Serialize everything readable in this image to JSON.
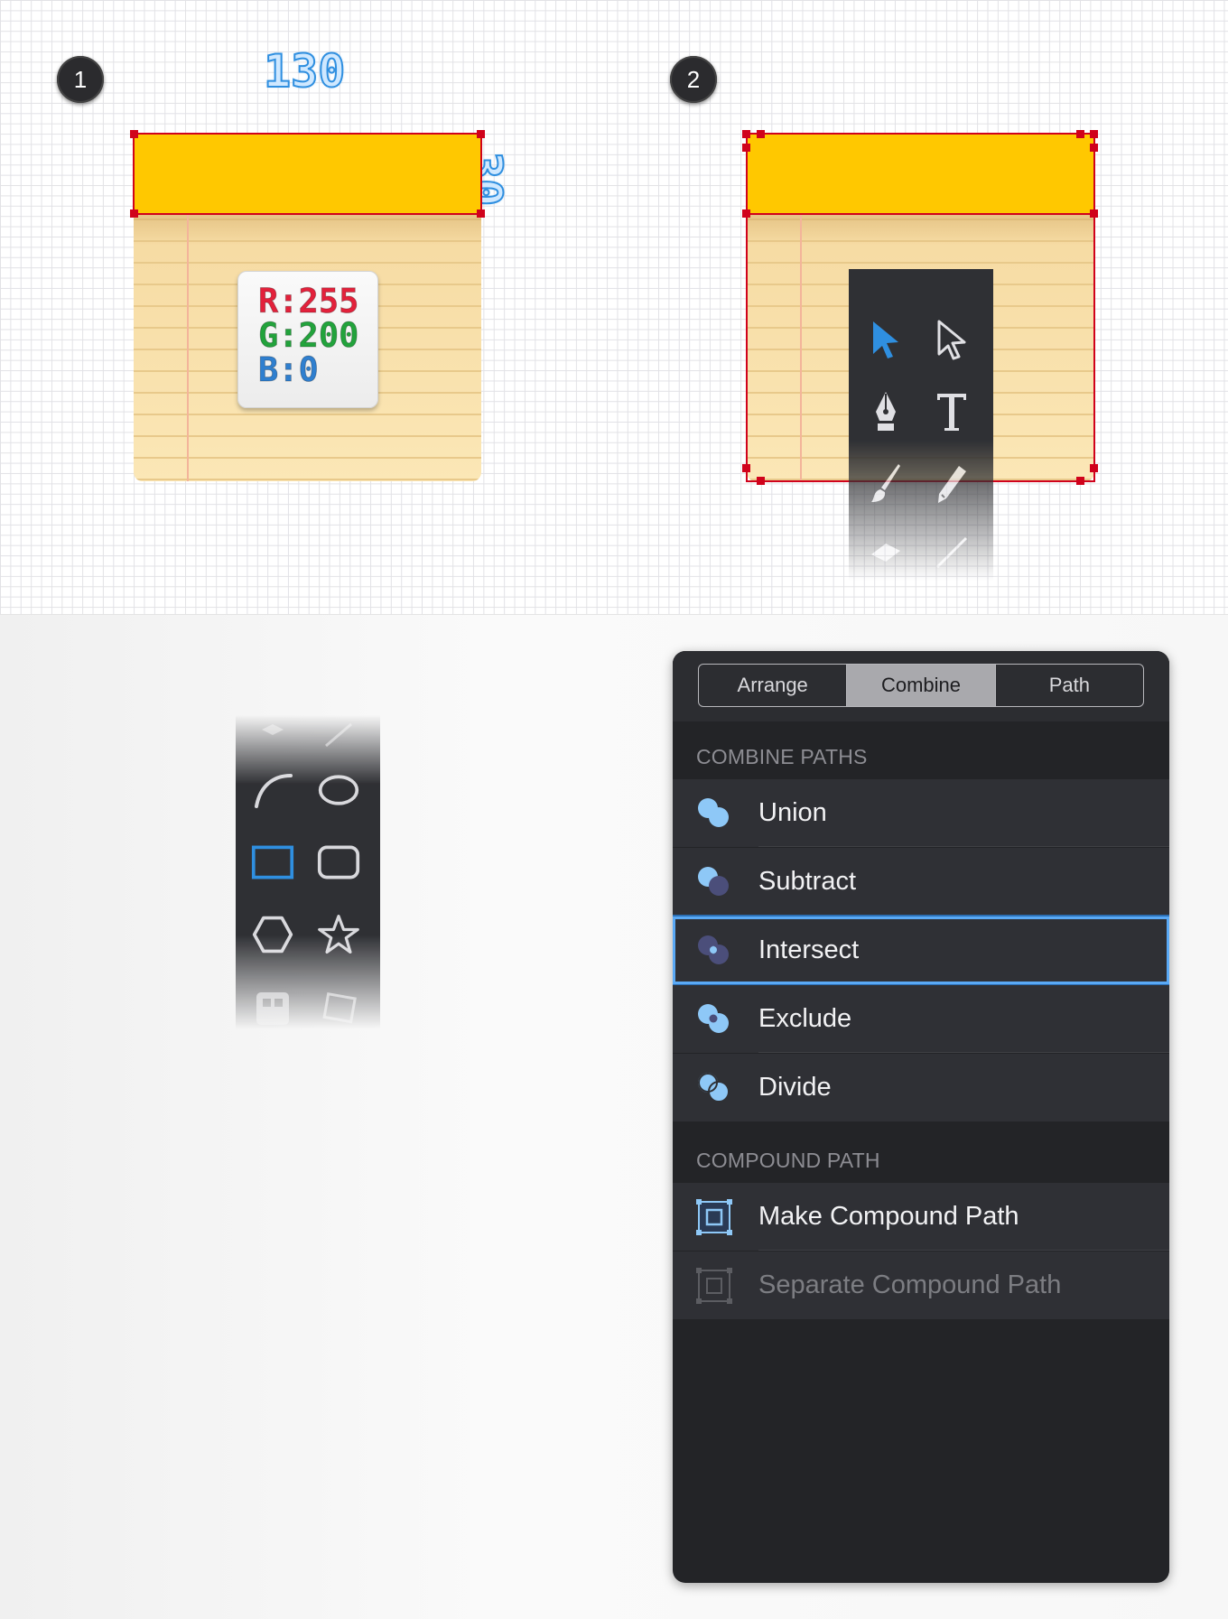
{
  "steps": {
    "one": "1",
    "two": "2"
  },
  "dimensions": {
    "width": "130",
    "height": "30"
  },
  "rgb": {
    "r": "R:255",
    "g": "G:200",
    "b": "B:0"
  },
  "colors": {
    "binding": "#ffc800",
    "selection": "#d0021b",
    "accent": "#2f8fe0",
    "r": "#e3213b",
    "g": "#22a33c",
    "b": "#2f7fcf"
  },
  "tools_top": [
    {
      "name": "select-arrow-icon",
      "active": true
    },
    {
      "name": "direct-select-arrow-icon"
    },
    {
      "name": "pen-icon"
    },
    {
      "name": "text-icon"
    },
    {
      "name": "brush-icon"
    },
    {
      "name": "pencil-icon"
    },
    {
      "name": "eraser-icon"
    },
    {
      "name": "line-icon"
    }
  ],
  "tools_shapes": [
    {
      "name": "arc-icon"
    },
    {
      "name": "ellipse-icon"
    },
    {
      "name": "rectangle-icon",
      "active": true
    },
    {
      "name": "rounded-rectangle-icon"
    },
    {
      "name": "polygon-icon"
    },
    {
      "name": "star-icon"
    }
  ],
  "panel": {
    "tabs": [
      "Arrange",
      "Combine",
      "Path"
    ],
    "active_tab": "Combine",
    "combine_header": "COMBINE PATHS",
    "combine_items": [
      "Union",
      "Subtract",
      "Intersect",
      "Exclude",
      "Divide"
    ],
    "selected_item": "Intersect",
    "compound_header": "COMPOUND PATH",
    "compound_items": [
      "Make Compound Path",
      "Separate Compound Path"
    ],
    "disabled_item": "Separate Compound Path"
  }
}
